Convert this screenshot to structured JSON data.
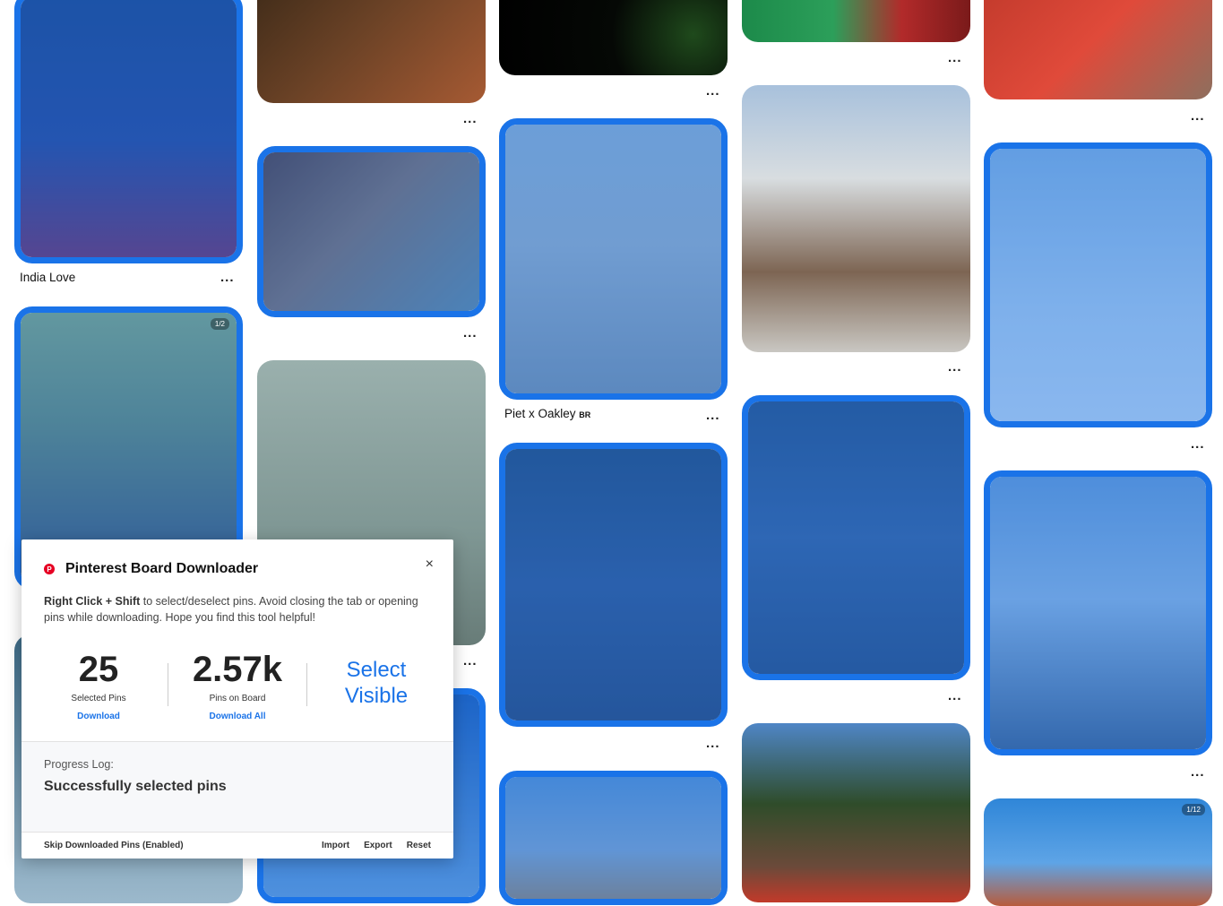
{
  "pins": {
    "india_love_title": "India Love",
    "piet_title": "Piet x Oakley",
    "piet_country": "BR",
    "badge_laundry": "1/2",
    "badge_bottom": "1/12",
    "more_label": "..."
  },
  "panel": {
    "logo_glyph": "P",
    "title": "Pinterest Board Downloader",
    "close_glyph": "×",
    "desc_bold": "Right Click + Shift",
    "desc_text": " to select/deselect pins. Avoid closing the tab or opening pins while downloading. Hope you find this tool helpful!",
    "selected_count": "25",
    "selected_label": "Selected Pins",
    "download_label": "Download",
    "board_count": "2.57k",
    "board_label": "Pins on Board",
    "download_all_label": "Download All",
    "select_visible_label": "Select Visible",
    "log_label": "Progress Log:",
    "log_message": "Successfully selected pins",
    "skip_label": "Skip Downloaded Pins (Enabled)",
    "import_label": "Import",
    "export_label": "Export",
    "reset_label": "Reset"
  },
  "colors": {
    "accent": "#1a73e8",
    "pinterest_red": "#e60023"
  }
}
